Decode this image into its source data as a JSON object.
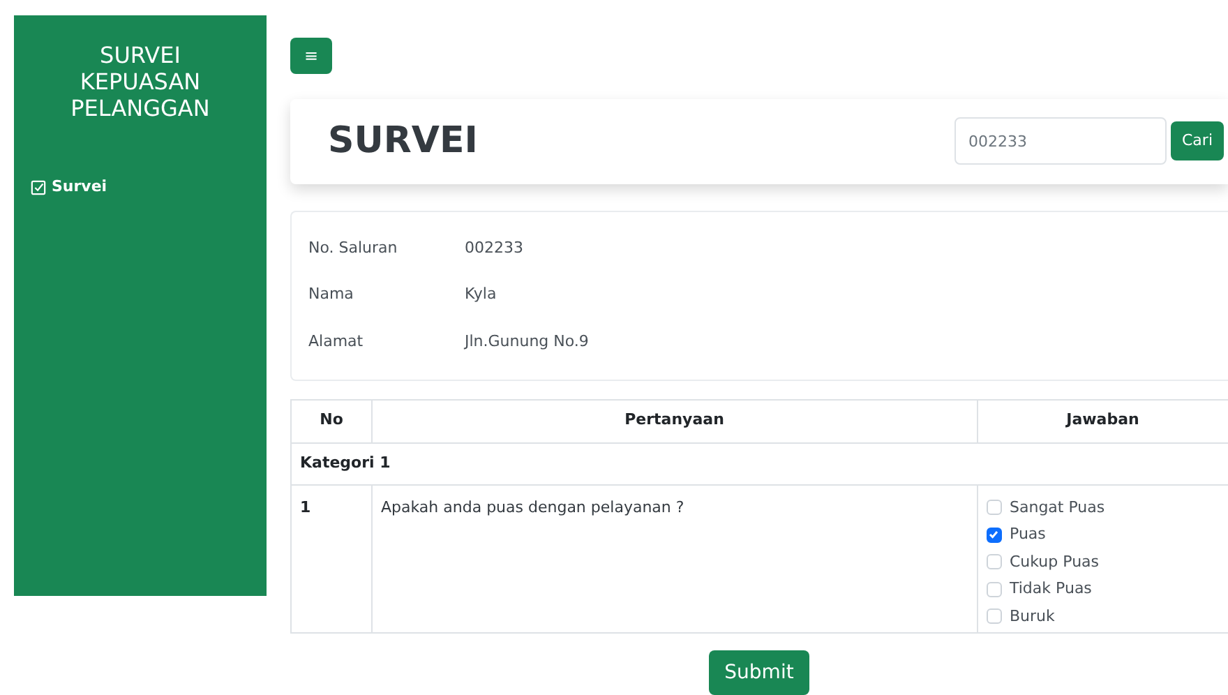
{
  "sidebar": {
    "title": "SURVEI KEPUASAN PELANGGAN",
    "items": [
      {
        "label": "Survei",
        "selected": true
      }
    ]
  },
  "menu_button": {
    "label": "≡"
  },
  "header": {
    "title": "SURVEI",
    "search": {
      "value": "002233"
    },
    "search_button": "Cari"
  },
  "info": [
    {
      "label": "No. Saluran",
      "value": "002233"
    },
    {
      "label": "Nama",
      "value": "Kyla"
    },
    {
      "label": "Alamat",
      "value": "Jln.Gunung No.9"
    }
  ],
  "table": {
    "columns": [
      "No",
      "Pertanyaan",
      "Jawaban"
    ],
    "categories": [
      {
        "title": "Kategori 1",
        "rows": [
          {
            "no": "1",
            "question": "Apakah anda puas dengan pelayanan ?",
            "options": [
              {
                "label": "Sangat Puas",
                "checked": false
              },
              {
                "label": "Puas",
                "checked": true
              },
              {
                "label": "Cukup Puas",
                "checked": false
              },
              {
                "label": "Tidak Puas",
                "checked": false
              },
              {
                "label": "Buruk",
                "checked": false
              }
            ]
          }
        ]
      }
    ]
  },
  "submit": "Submit"
}
